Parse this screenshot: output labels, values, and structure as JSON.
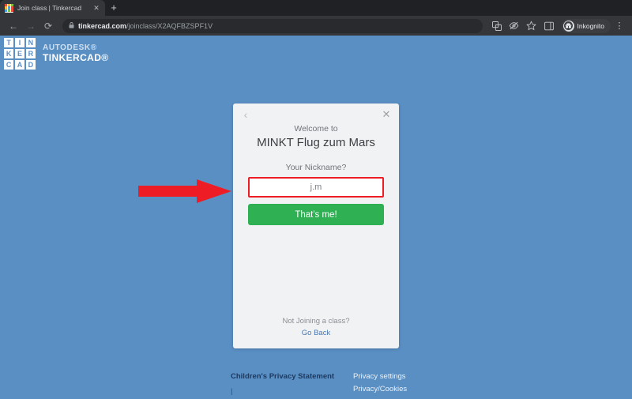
{
  "browser": {
    "tab": {
      "title": "Join class | Tinkercad",
      "favicon_name": "tinkercad-favicon",
      "close_glyph": "✕",
      "favicon_colors": [
        "#e8483c",
        "#f4b63f",
        "#7ac143",
        "#f4b63f",
        "#4aa3df",
        "#e8483c",
        "#4aa3df",
        "#7ac143",
        "#e8483c"
      ]
    },
    "new_tab_glyph": "+",
    "nav": {
      "back_glyph": "←",
      "forward_glyph": "→",
      "reload_glyph": "⟳"
    },
    "omnibox": {
      "lock_glyph": "🔒",
      "host": "tinkercad.com",
      "path": "/joinclass/X2AQFBZSPF1V"
    },
    "toolbar_icons": [
      {
        "name": "translate-icon",
        "glyph": "⎘"
      },
      {
        "name": "eye-slash-icon",
        "glyph": "⌽"
      },
      {
        "name": "bookmark-star-icon",
        "glyph": "☆"
      },
      {
        "name": "side-panel-icon",
        "glyph": "◫"
      }
    ],
    "incognito": {
      "avatar_glyph": "●",
      "label": "Inkognito"
    },
    "menu_glyph": "⋮"
  },
  "brand": {
    "logo_letters": [
      "T",
      "I",
      "N",
      "K",
      "E",
      "R",
      "C",
      "A",
      "D"
    ],
    "autodesk": "AUTODESK®",
    "tinkercad": "TINKERCAD®"
  },
  "annotation": {
    "arrow_name": "red-arrow-pointing-to-nickname-input",
    "color": "#ee1c25"
  },
  "modal": {
    "back_glyph": "‹",
    "close_glyph": "✕",
    "welcome_label": "Welcome to",
    "class_title": "MINKT Flug zum Mars",
    "nickname_label": "Your Nickname?",
    "nickname_value": "j.m",
    "nickname_placeholder": "",
    "submit_label": "That's me!",
    "not_joining_label": "Not Joining a class?",
    "go_back_label": "Go Back"
  },
  "footer": {
    "children_privacy": "Children's Privacy Statement",
    "separator": "|",
    "privacy_settings": "Privacy settings",
    "privacy_cookies": "Privacy/Cookies"
  },
  "colors": {
    "page_background": "#5a8fc4",
    "modal_background": "#f1f2f3",
    "accent_green": "#2eb053",
    "highlight_red": "#ee1c25",
    "link_blue": "#4a77ad"
  }
}
